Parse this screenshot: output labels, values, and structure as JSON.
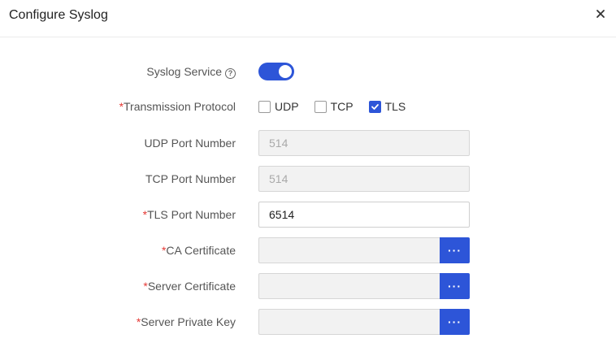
{
  "dialog": {
    "title": "Configure Syslog",
    "close_icon": "close-icon"
  },
  "fields": {
    "syslog_service": {
      "label": "Syslog Service",
      "help_glyph": "?",
      "enabled": true
    },
    "transmission_protocol": {
      "required_mark": "*",
      "label": "Transmission Protocol",
      "options": [
        {
          "label": "UDP",
          "checked": false
        },
        {
          "label": "TCP",
          "checked": false
        },
        {
          "label": "TLS",
          "checked": true
        }
      ]
    },
    "udp_port": {
      "label": "UDP Port Number",
      "value": "514"
    },
    "tcp_port": {
      "label": "TCP Port Number",
      "value": "514"
    },
    "tls_port": {
      "required_mark": "*",
      "label": "TLS Port Number",
      "value": "6514"
    },
    "ca_certificate": {
      "required_mark": "*",
      "label": "CA Certificate",
      "value": "",
      "browse_glyph": "···"
    },
    "server_certificate": {
      "required_mark": "*",
      "label": "Server Certificate",
      "value": "",
      "browse_glyph": "···"
    },
    "server_private_key": {
      "required_mark": "*",
      "label": "Server Private Key",
      "value": "",
      "browse_glyph": "···"
    }
  },
  "colors": {
    "accent": "#2d55d8",
    "required": "#e53935"
  }
}
